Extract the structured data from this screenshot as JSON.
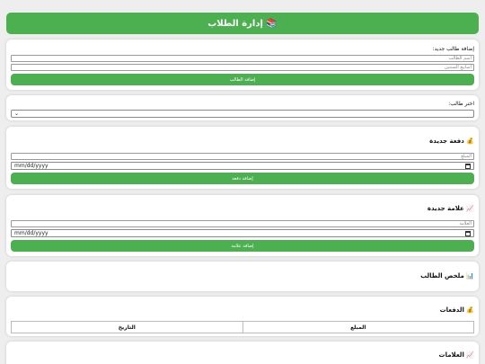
{
  "header": {
    "title": "📚 إدارة الطلاب"
  },
  "add_student": {
    "label": "إضافة طالب جديد:",
    "name_placeholder": "اسم الطالب",
    "weeks_placeholder": "أسابيع السنتين",
    "button": "إضافة الطالب"
  },
  "select_student": {
    "label": "اختر طالب:",
    "value": ""
  },
  "payment": {
    "title": "💰 دفعة جديدة",
    "amount_placeholder": "المبلغ",
    "date_placeholder": "mm/dd/yyyy",
    "button": "إضافة دفعة"
  },
  "grade": {
    "title": "📈 علامة جديدة",
    "grade_placeholder": "العلامة",
    "date_placeholder": "mm/dd/yyyy",
    "button": "إضافة علامة"
  },
  "summary": {
    "title": "📊 ملخص الطالب"
  },
  "payments_table": {
    "title": "💰 الدفعات",
    "columns": [
      "المبلغ",
      "التاريخ"
    ]
  },
  "grades_table": {
    "title": "📈 العلامات"
  },
  "colors": {
    "accent": "#4caf50",
    "background": "#eeeeee"
  }
}
